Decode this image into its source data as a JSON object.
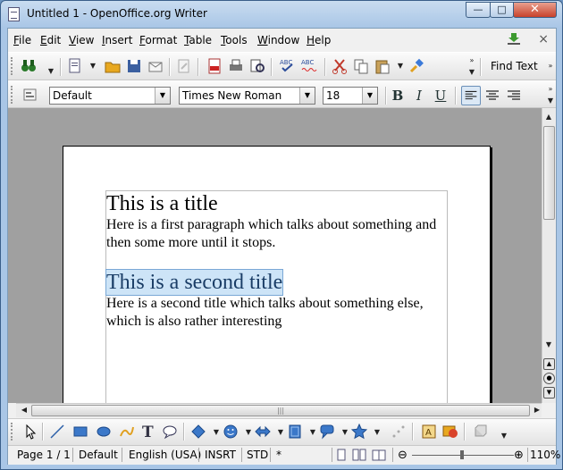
{
  "window": {
    "title": "Untitled 1 - OpenOffice.org Writer",
    "controls": {
      "minimize": "—",
      "maximize": "□",
      "close": "✕"
    }
  },
  "menu": {
    "items": [
      {
        "label": "File",
        "u": "F",
        "rest": "ile"
      },
      {
        "label": "Edit",
        "u": "E",
        "rest": "dit"
      },
      {
        "label": "View",
        "u": "V",
        "rest": "iew"
      },
      {
        "label": "Insert",
        "u": "I",
        "rest": "nsert"
      },
      {
        "label": "Format",
        "u": "F",
        "rest": "ormat"
      },
      {
        "label": "Table",
        "u": "T",
        "rest": "able"
      },
      {
        "label": "Tools",
        "u": "T",
        "rest": "ools"
      },
      {
        "label": "Window",
        "u": "W",
        "rest": "indow"
      },
      {
        "label": "Help",
        "u": "H",
        "rest": "elp"
      }
    ],
    "close_doc": "×"
  },
  "toolbar": {
    "find_text": "Find Text",
    "more": "»"
  },
  "formatting": {
    "style": "Default",
    "font": "Times New Roman",
    "size": "18",
    "bold": "B",
    "italic": "I",
    "underline": "U"
  },
  "document": {
    "title1": "This is a title",
    "para1": "Here is a first paragraph which talks about something and then some more until it stops.",
    "title2": "This is a second title",
    "para2": "Here is a second title which talks about something else, which is also rather interesting"
  },
  "statusbar": {
    "page": "Page 1 / 1",
    "style": "Default",
    "language": "English (USA)",
    "insert_mode": "INSRT",
    "selection_mode": "STD",
    "modified": "*",
    "zoom": "110%"
  },
  "colors": {
    "titlebar": "#a9c6e6",
    "selection": "#cde4f7",
    "workarea": "#a0a0a0"
  }
}
